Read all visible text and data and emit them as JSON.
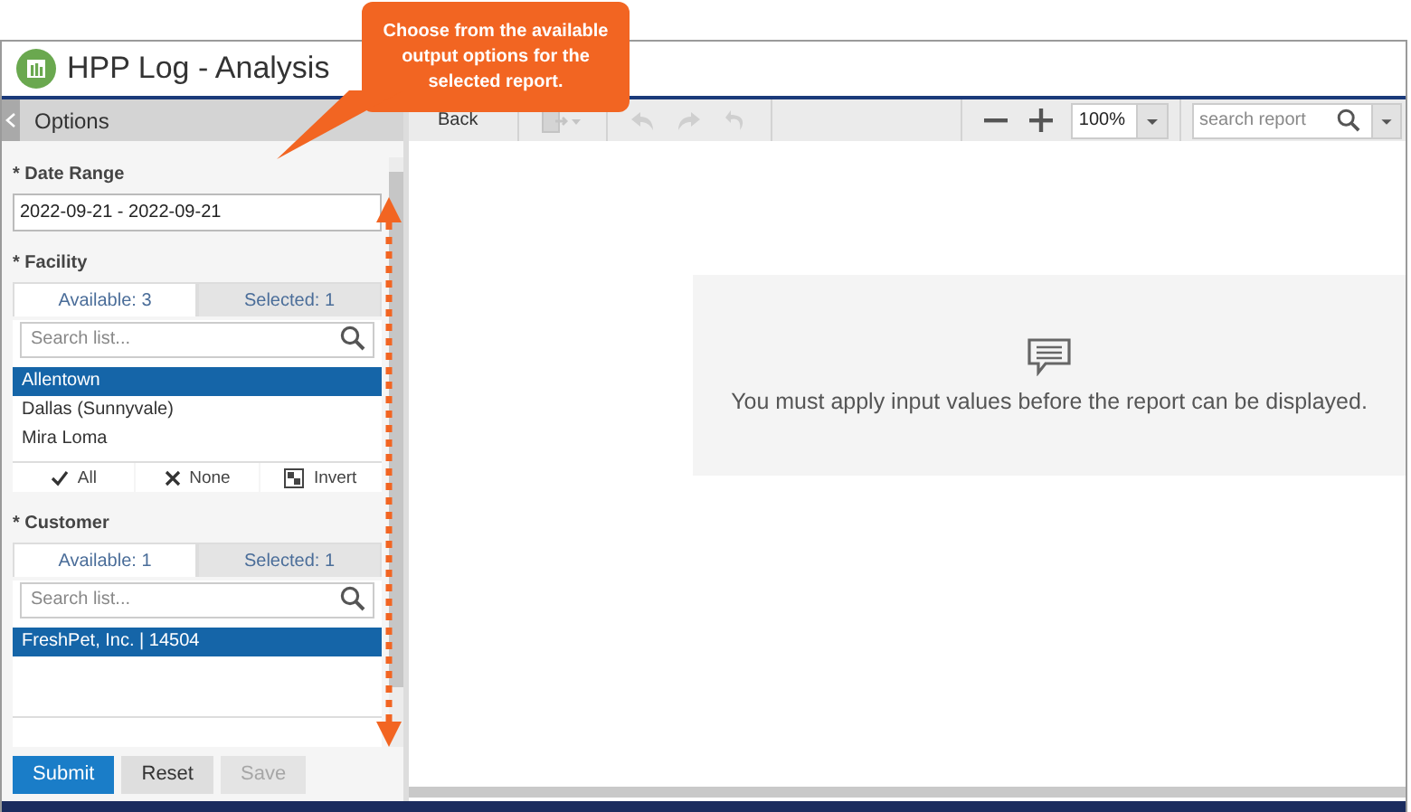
{
  "window": {
    "title": "HPP Log - Analysis"
  },
  "callout": {
    "text": "Choose from the available output options for the selected report."
  },
  "options_panel": {
    "title": "Options",
    "parameters": [
      {
        "kind": "text",
        "label": "* Date Range",
        "value": "2022-09-21 - 2022-09-21"
      },
      {
        "kind": "multiselect",
        "label": "* Facility",
        "tabs": [
          {
            "label": "Available: 3",
            "selected": true
          },
          {
            "label": "Selected: 1",
            "selected": false
          }
        ],
        "search_placeholder": "Search list...",
        "items": [
          {
            "label": "Allentown",
            "selected": true
          },
          {
            "label": "Dallas (Sunnyvale)",
            "selected": false
          },
          {
            "label": "Mira Loma",
            "selected": false
          }
        ],
        "actions": [
          {
            "kind": "all",
            "label": "All"
          },
          {
            "kind": "none",
            "label": "None"
          },
          {
            "kind": "invert",
            "label": "Invert"
          }
        ]
      },
      {
        "kind": "multiselect",
        "label": "* Customer",
        "tabs": [
          {
            "label": "Available: 1",
            "selected": true
          },
          {
            "label": "Selected: 1",
            "selected": false
          }
        ],
        "search_placeholder": "Search list...",
        "items": [
          {
            "label": "FreshPet, Inc. | 14504",
            "selected": true
          }
        ]
      }
    ],
    "buttons": [
      {
        "label": "Submit",
        "kind": "primary",
        "disabled": false
      },
      {
        "label": "Reset",
        "kind": "secondary",
        "disabled": false
      },
      {
        "label": "Save",
        "kind": "secondary",
        "disabled": true
      }
    ]
  },
  "toolbar": {
    "back": "Back",
    "zoom": "100%",
    "search_placeholder": "search report"
  },
  "report": {
    "message": "You must apply input values before the report can be displayed."
  }
}
